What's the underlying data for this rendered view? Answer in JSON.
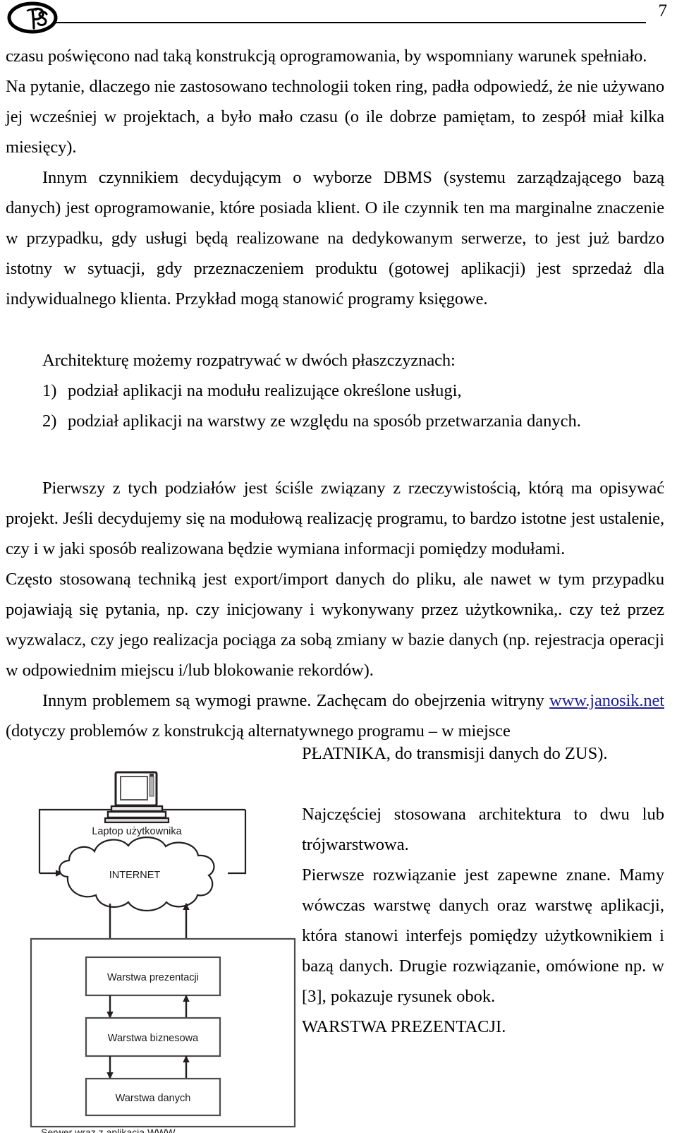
{
  "header": {
    "page_number": "7",
    "logo": "ps-monogram-logo"
  },
  "body": {
    "paragraphs": [
      {
        "id": "p1",
        "indent": false,
        "text": "czasu poświęcono nad taką konstrukcją oprogramowania, by wspomniany warunek spełniało."
      },
      {
        "id": "p2",
        "indent": false,
        "text": "Na pytanie, dlaczego nie zastosowano technologii token ring, padła odpowiedź, że nie używano jej wcześniej w projektach, a było mało czasu (o ile dobrze pamiętam, to zespół miał kilka miesięcy)."
      },
      {
        "id": "p3",
        "indent": true,
        "text": "Innym czynnikiem decydującym o wyborze DBMS (systemu zarządzającego bazą danych) jest oprogramowanie, które posiada klient. O ile czynnik ten ma marginalne znaczenie w przypadku, gdy usługi będą realizowane na dedykowanym serwerze, to jest już bardzo istotny w sytuacji, gdy przeznaczeniem produktu (gotowej aplikacji) jest sprzedaż dla indywidualnego klienta. Przykład mogą stanowić programy księgowe."
      }
    ],
    "architecture_intro": "Architekturę możemy rozpatrywać w dwóch płaszczyznach:",
    "architecture_list": [
      {
        "num": "1)",
        "text": "podział aplikacji na modułu realizujące określone usługi,"
      },
      {
        "num": "2)",
        "text": "podział aplikacji na warstwy ze względu na sposób przetwarzania danych."
      }
    ],
    "paragraphs2": [
      {
        "id": "p4",
        "indent": true,
        "text": "Pierwszy z tych podziałów jest ściśle związany z rzeczywistością, którą ma opisywać projekt. Jeśli decydujemy się na modułową realizację programu, to bardzo istotne jest ustalenie, czy i w jaki sposób realizowana będzie wymiana informacji pomiędzy modułami."
      },
      {
        "id": "p5",
        "indent": false,
        "text": "Często stosowaną techniką jest export/import danych do pliku, ale nawet w tym przypadku pojawiają się pytania, np. czy inicjowany i wykonywany przez użytkownika,. czy też przez wyzwalacz, czy jego realizacja pociąga za sobą zmiany w bazie danych (np. rejestracja operacji w odpowiednim miejscu i/lub blokowanie rekordów)."
      }
    ],
    "link_paragraph": {
      "lead": "Innym problemem są wymogi prawne. Zachęcam do obejrzenia witryny ",
      "link_text": "www.janosik.net",
      "tail": " (dotyczy problemów z konstrukcją alternatywnego programu – w miejsce"
    }
  },
  "right_column": {
    "paragraphs": [
      "PŁATNIKA, do transmisji danych do ZUS).",
      "Najczęściej stosowana architektura to dwu lub trójwarstwowa.",
      "Pierwsze rozwiązanie jest zapewne znane. Mamy wówczas warstwę danych oraz warstwę aplikacji, która stanowi interfejs pomiędzy użytkownikiem i bazą danych. Drugie rozwiązanie, omówione np. w [3], pokazuje rysunek obok.",
      "WARSTWA PREZENTACJI."
    ]
  },
  "diagram": {
    "name": "three-tier-architecture-diagram",
    "laptop_label": "Laptop użytkownika",
    "cloud_label": "INTERNET",
    "server_label": "Serwer wraz z aplikacją WWW",
    "layers": [
      "Warstwa prezentacji",
      "Warstwa biznesowa",
      "Warstwa danych"
    ],
    "colors": {
      "line": "#231f20",
      "box_border": "#4d4d4d",
      "text": "#1a1a1a"
    }
  }
}
